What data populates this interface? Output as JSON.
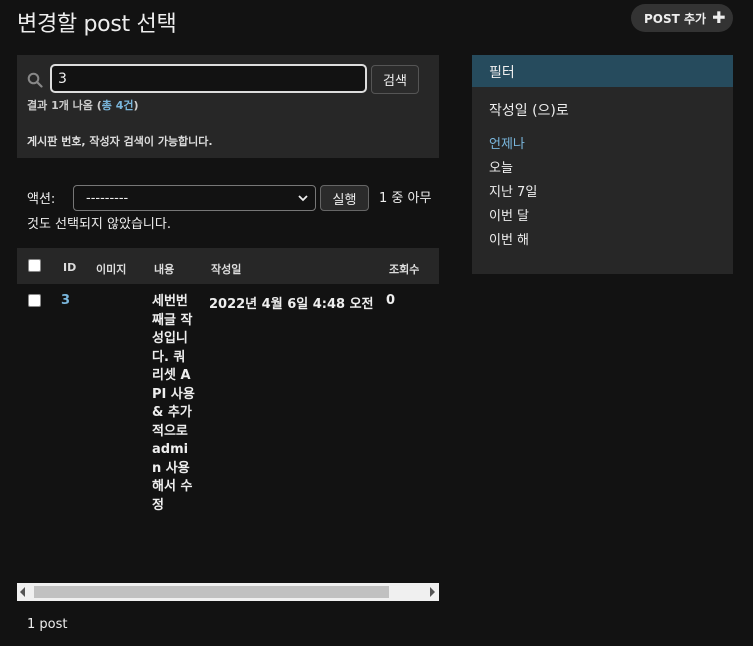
{
  "header": {
    "title": "변경할 post 선택",
    "add_label": "POST 추가"
  },
  "search": {
    "value": "3",
    "button_label": "검색",
    "result_prefix": "결과 1개 나옴 (",
    "result_link": "총 4건",
    "result_suffix": ")",
    "help": "게시판 번호, 작성자 검색이 가능합니다."
  },
  "actions": {
    "label": "액션:",
    "selected": "---------",
    "run_label": "실행",
    "counter": "1 중 아무것도 선택되지 않았습니다."
  },
  "table": {
    "headers": [
      "ID",
      "이미지",
      "내용",
      "작성일",
      "조회수"
    ],
    "rows": [
      {
        "id": "3",
        "image": "",
        "content": "세번번째글 작성입니다. 쿼리셋 API 사용 & 추가적으로 admin 사용해서 수정",
        "date": "2022년 4월 6일 4:48 오전",
        "views": "0"
      }
    ]
  },
  "paginator": "1 post",
  "filter": {
    "title": "필터",
    "subtitle": "작성일 (으)로",
    "options": [
      "언제나",
      "오늘",
      "지난 7일",
      "이번 달",
      "이번 해"
    ],
    "selected_index": 0
  },
  "colors": {
    "link": "#7ab7dd",
    "filter_header": "#264b5d",
    "panel": "#272727",
    "background": "#121212"
  }
}
